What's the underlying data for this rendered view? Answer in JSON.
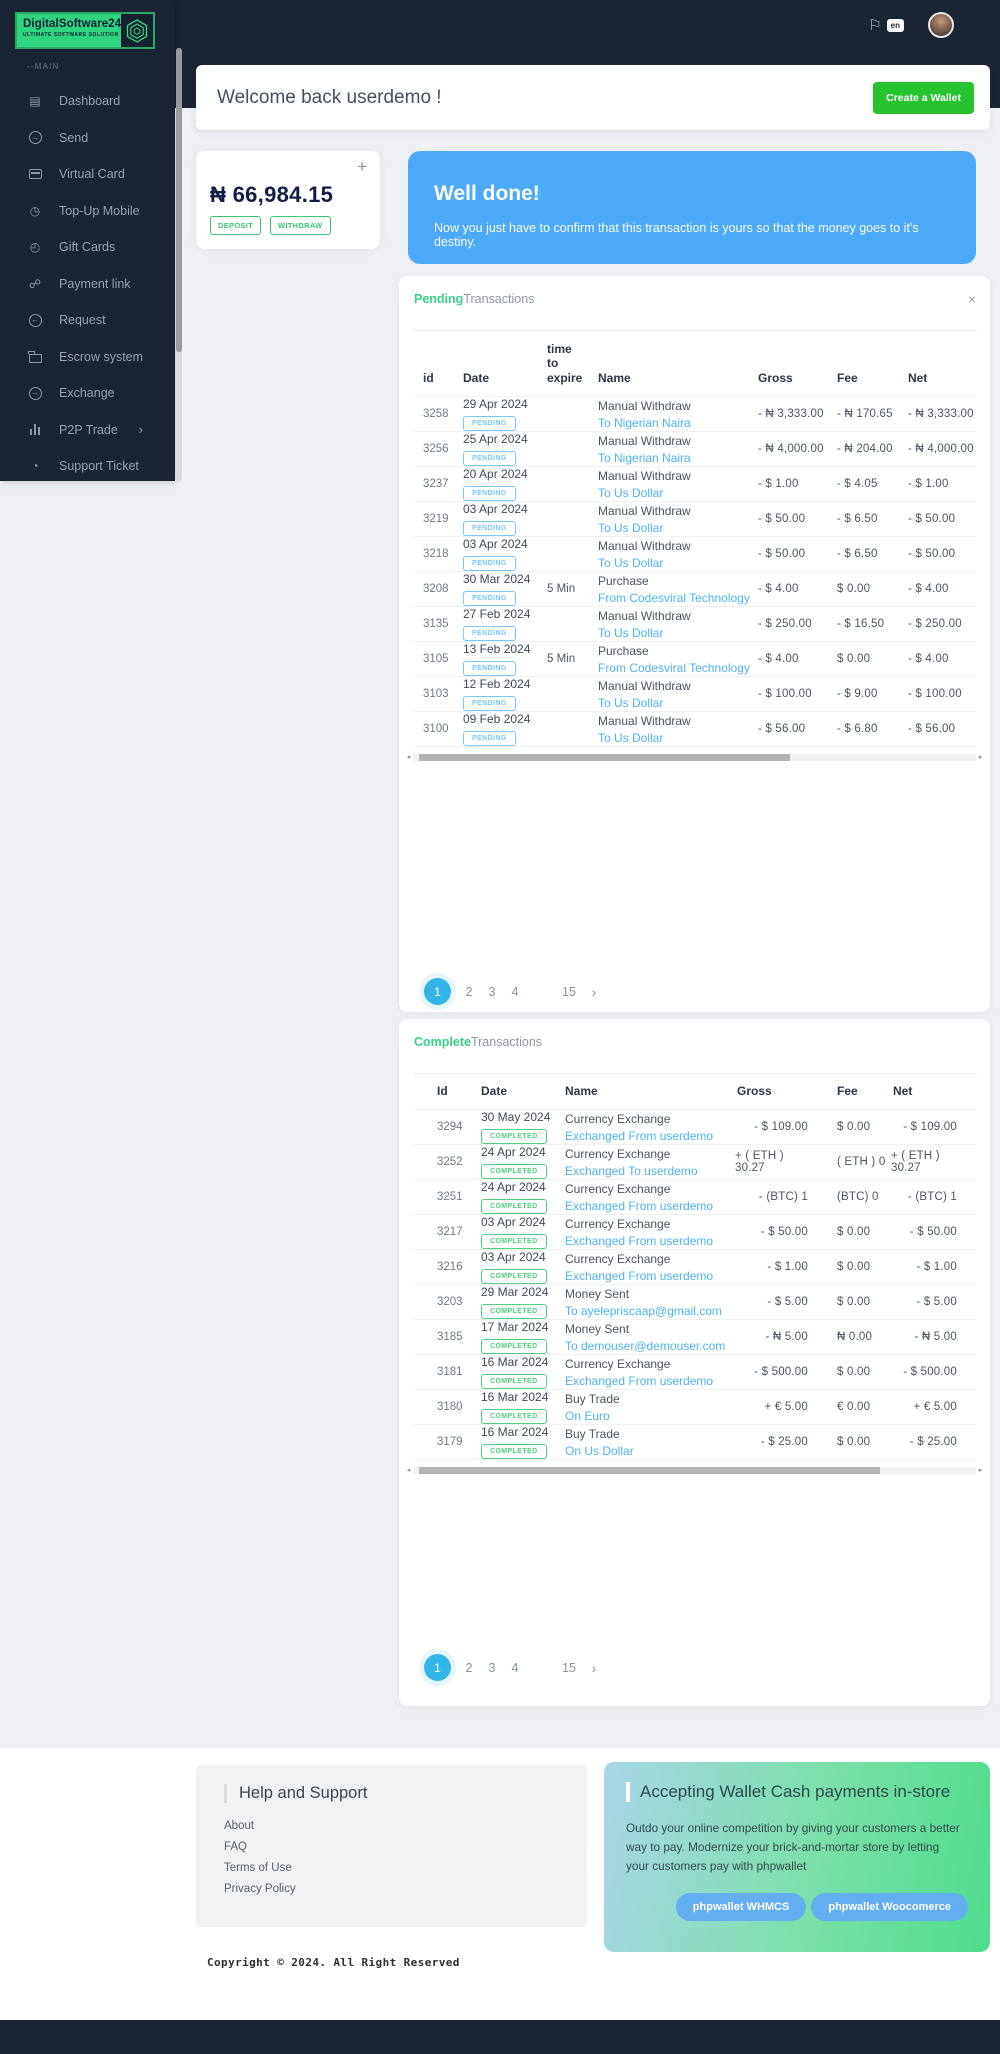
{
  "brand": {
    "name": "DigitalSoftware24",
    "tagline": "ULTIMATE SOFTWARE SOLUTION"
  },
  "header": {
    "lang_badge": "en"
  },
  "sidebar": {
    "section_label": "--MAIN",
    "items": [
      {
        "key": "dashboard",
        "icon_name": "layers-icon",
        "label": "Dashboard"
      },
      {
        "key": "send",
        "icon_name": "send-icon",
        "label": "Send"
      },
      {
        "key": "virtual-card",
        "icon_name": "credit-card-icon",
        "label": "Virtual Card"
      },
      {
        "key": "top-up-mobile",
        "icon_name": "topup-icon",
        "label": "Top-Up Mobile"
      },
      {
        "key": "gift-cards",
        "icon_name": "gift-card-icon",
        "label": "Gift Cards"
      },
      {
        "key": "payment-link",
        "icon_name": "link-icon",
        "label": "Payment link"
      },
      {
        "key": "request",
        "icon_name": "request-icon",
        "label": "Request"
      },
      {
        "key": "escrow-system",
        "icon_name": "folder-icon",
        "label": "Escrow system"
      },
      {
        "key": "exchange",
        "icon_name": "exchange-icon",
        "label": "Exchange"
      },
      {
        "key": "p2p-trade",
        "icon_name": "chart-bars-icon",
        "label": "P2P Trade",
        "chevron": "›"
      },
      {
        "key": "support-ticket",
        "icon_name": "clock-icon",
        "label": "Support Ticket"
      }
    ]
  },
  "welcome": {
    "title": "Welcome back userdemo !",
    "create_wallet_label": "Create a Wallet"
  },
  "balance": {
    "amount": "₦ 66,984.15",
    "plus_symbol": "+",
    "deposit_label": "DEPOSIT",
    "withdraw_label": "WITHDRAW"
  },
  "banner": {
    "title": "Well done!",
    "message": "Now you just have to confirm that this transaction is yours so that the money goes to it's destiny."
  },
  "pending": {
    "title_accent": "Pending",
    "title_rest": "Transactions",
    "close_symbol": "×",
    "badge": "PENDING",
    "columns": [
      "id",
      "Date",
      "time to expire",
      "Name",
      "Gross",
      "Fee",
      "Net"
    ],
    "rows": [
      {
        "id": "3258",
        "date": "29 Apr 2024",
        "expire": "",
        "name": "Manual Withdraw",
        "link": "To Nigerian Naira",
        "gross": "- ₦ 3,333.00",
        "fee": "- ₦ 170.65",
        "net": "- ₦ 3,333.00"
      },
      {
        "id": "3256",
        "date": "25 Apr 2024",
        "expire": "",
        "name": "Manual Withdraw",
        "link": "To Nigerian Naira",
        "gross": "- ₦ 4,000.00",
        "fee": "- ₦ 204.00",
        "net": "- ₦ 4,000.00"
      },
      {
        "id": "3237",
        "date": "20 Apr 2024",
        "expire": "",
        "name": "Manual Withdraw",
        "link": "To Us Dollar",
        "gross": "- $ 1.00",
        "fee": "- $ 4.05",
        "net": "- $ 1.00"
      },
      {
        "id": "3219",
        "date": "03 Apr 2024",
        "expire": "",
        "name": "Manual Withdraw",
        "link": "To Us Dollar",
        "gross": "- $ 50.00",
        "fee": "- $ 6.50",
        "net": "- $ 50.00"
      },
      {
        "id": "3218",
        "date": "03 Apr 2024",
        "expire": "",
        "name": "Manual Withdraw",
        "link": "To Us Dollar",
        "gross": "- $ 50.00",
        "fee": "- $ 6.50",
        "net": "- $ 50.00"
      },
      {
        "id": "3208",
        "date": "30 Mar 2024",
        "expire": "5 Min",
        "name": "Purchase",
        "link": "From Codesviral Technology",
        "gross": "- $ 4.00",
        "fee": "$ 0.00",
        "net": "- $ 4.00"
      },
      {
        "id": "3135",
        "date": "27 Feb 2024",
        "expire": "",
        "name": "Manual Withdraw",
        "link": "To Us Dollar",
        "gross": "- $ 250.00",
        "fee": "- $ 16.50",
        "net": "- $ 250.00"
      },
      {
        "id": "3105",
        "date": "13 Feb 2024",
        "expire": "5 Min",
        "name": "Purchase",
        "link": "From Codesviral Technology",
        "gross": "- $ 4.00",
        "fee": "$ 0.00",
        "net": "- $ 4.00"
      },
      {
        "id": "3103",
        "date": "12 Feb 2024",
        "expire": "",
        "name": "Manual Withdraw",
        "link": "To Us Dollar",
        "gross": "- $ 100.00",
        "fee": "- $ 9.00",
        "net": "- $ 100.00"
      },
      {
        "id": "3100",
        "date": "09 Feb 2024",
        "expire": "",
        "name": "Manual Withdraw",
        "link": "To Us Dollar",
        "gross": "- $ 56.00",
        "fee": "- $ 6.80",
        "net": "- $ 56.00"
      }
    ]
  },
  "complete": {
    "title_accent": "Complete",
    "title_rest": "Transactions",
    "badge": "COMPLETED",
    "columns": [
      "Id",
      "Date",
      "Name",
      "Gross",
      "Fee",
      "Net"
    ],
    "rows": [
      {
        "id": "3294",
        "date": "30 May 2024",
        "name": "Currency Exchange",
        "link": "Exchanged From userdemo",
        "gross": "- $ 109.00",
        "fee": "$ 0.00",
        "net": "- $ 109.00"
      },
      {
        "id": "3252",
        "date": "24 Apr 2024",
        "name": "Currency Exchange",
        "link": "Exchanged To userdemo",
        "gross": "+ ( ETH ) 30.27",
        "fee": "( ETH ) 0",
        "net": "+ ( ETH ) 30.27"
      },
      {
        "id": "3251",
        "date": "24 Apr 2024",
        "name": "Currency Exchange",
        "link": "Exchanged From userdemo",
        "gross": "- (BTC) 1",
        "fee": "(BTC) 0",
        "net": "- (BTC) 1"
      },
      {
        "id": "3217",
        "date": "03 Apr 2024",
        "name": "Currency Exchange",
        "link": "Exchanged From userdemo",
        "gross": "- $ 50.00",
        "fee": "$ 0.00",
        "net": "- $ 50.00"
      },
      {
        "id": "3216",
        "date": "03 Apr 2024",
        "name": "Currency Exchange",
        "link": "Exchanged From userdemo",
        "gross": "- $ 1.00",
        "fee": "$ 0.00",
        "net": "- $ 1.00"
      },
      {
        "id": "3203",
        "date": "29 Mar 2024",
        "name": "Money Sent",
        "link": "To ayelepriscaap@gmail.com",
        "gross": "- $ 5.00",
        "fee": "$ 0.00",
        "net": "- $ 5.00"
      },
      {
        "id": "3185",
        "date": "17 Mar 2024",
        "name": "Money Sent",
        "link": "To demouser@demouser.com",
        "gross": "- ₦ 5.00",
        "fee": "₦ 0.00",
        "net": "- ₦ 5.00"
      },
      {
        "id": "3181",
        "date": "16 Mar 2024",
        "name": "Currency Exchange",
        "link": "Exchanged From userdemo",
        "gross": "- $ 500.00",
        "fee": "$ 0.00",
        "net": "- $ 500.00"
      },
      {
        "id": "3180",
        "date": "16 Mar 2024",
        "name": "Buy Trade",
        "link": "On Euro",
        "gross": "+ € 5.00",
        "fee": "€ 0.00",
        "net": "+ € 5.00"
      },
      {
        "id": "3179",
        "date": "16 Mar 2024",
        "name": "Buy Trade",
        "link": "On Us Dollar",
        "gross": "- $ 25.00",
        "fee": "$ 0.00",
        "net": "- $ 25.00"
      }
    ]
  },
  "pagination": {
    "active": "1",
    "pages": [
      "1",
      "2",
      "3",
      "4"
    ],
    "last_page": "15",
    "next_symbol": "›"
  },
  "footer": {
    "help": {
      "title": "Help and Support",
      "links": [
        "About",
        "FAQ",
        "Terms of Use",
        "Privacy Policy"
      ]
    },
    "accept": {
      "title": "Accepting Wallet Cash payments in-store",
      "body": "Outdo your online competition by giving your customers a better way to pay. Modernize your brick-and-mortar store by letting your customers pay with phpwallet",
      "buttons": [
        "phpwallet WHMCS",
        "phpwallet Woocomerce"
      ]
    },
    "copyright": "Copyright © 2024. All Right Reserved"
  },
  "colors": {
    "dark_navy": "#1b2433",
    "brand_green": "#2ed47e",
    "button_green": "#26c32e",
    "banner_blue": "#4caaf8",
    "link_blue": "#4fb3f0",
    "pending_badge": "#79c8f7",
    "completed_badge": "#4ed17f",
    "pagination_active": "#33b5e8"
  }
}
